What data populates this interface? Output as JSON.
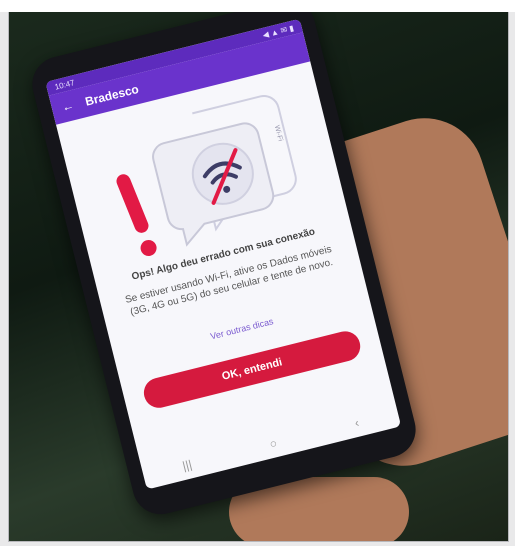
{
  "headline_fragment": "",
  "phone": {
    "status_time": "10:47",
    "status_icons": "◀ ▲ ✉ ▮",
    "appbar": {
      "back_icon": "arrow-left-icon",
      "title": "Bradesco"
    },
    "illustration": {
      "side_text": "Wi-Fi",
      "icons": [
        "exclamation-icon",
        "wifi-off-icon",
        "chat-bubble-icon"
      ]
    },
    "message": {
      "title": "Ops! Algo deu errado com sua conexão",
      "body": "Se estiver usando Wi-Fi, ative os Dados móveis (3G, 4G ou 5G) do seu celular e tente de novo."
    },
    "tips_link": "Ver outras dicas",
    "ok_button": "OK, entendi",
    "navbar": [
      "|||",
      "○",
      "‹"
    ],
    "colors": {
      "accent": "#6a33cc",
      "button": "#d51a3e",
      "error": "#e21a45"
    }
  }
}
